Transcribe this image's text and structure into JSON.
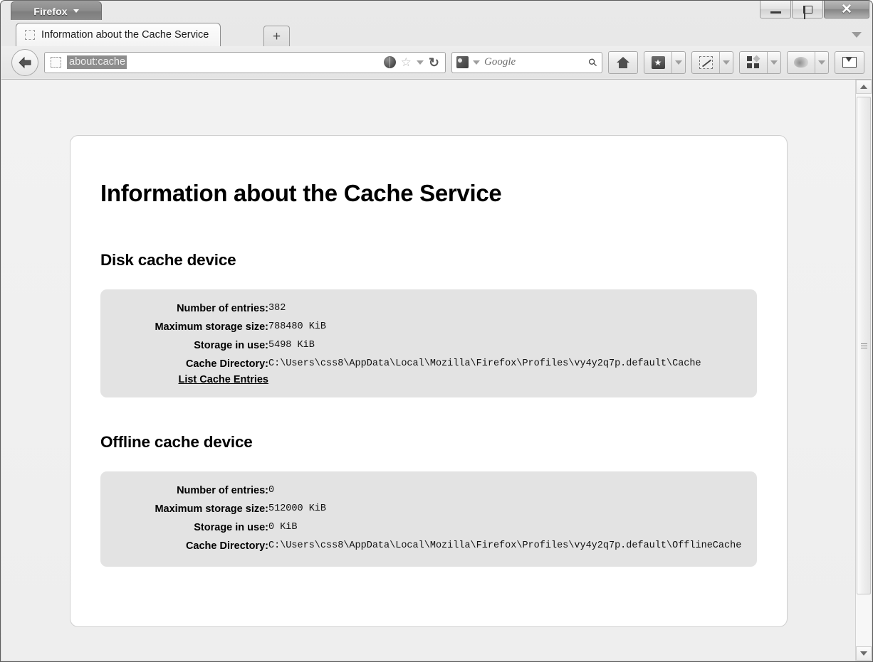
{
  "browser": {
    "app_menu_label": "Firefox",
    "window_controls": {
      "minimize": "minimize-button",
      "maximize": "maximize-button",
      "close": "✕"
    },
    "tab": {
      "title": "Information about the Cache Service",
      "new_tab_label": "+"
    },
    "urlbar": {
      "value": "about:cache"
    },
    "searchbar": {
      "placeholder": "Google",
      "engine": "google-icon",
      "magnifier": "🔍"
    },
    "toolbar_buttons": [
      {
        "name": "home-button",
        "icon": "home-icon"
      },
      {
        "name": "bookmarks-button",
        "icon": "bookmark-star-icon"
      },
      {
        "name": "snip-tool-button",
        "icon": "scissors-select-icon"
      },
      {
        "name": "apps-grid-button",
        "icon": "grid-squares-icon"
      },
      {
        "name": "weather-button",
        "icon": "cloud-icon"
      },
      {
        "name": "mail-button",
        "icon": "envelope-icon"
      }
    ]
  },
  "page": {
    "title": "Information about the Cache Service",
    "sections": [
      {
        "heading": "Disk cache device",
        "rows": [
          {
            "label": "Number of entries:",
            "value": "382"
          },
          {
            "label": "Maximum storage size:",
            "value": "788480 KiB"
          },
          {
            "label": "Storage in use:",
            "value": "5498 KiB"
          },
          {
            "label": "Cache Directory:",
            "value": "C:\\Users\\css8\\AppData\\Local\\Mozilla\\Firefox\\Profiles\\vy4y2q7p.default\\Cache"
          }
        ],
        "link": "List Cache Entries"
      },
      {
        "heading": "Offline cache device",
        "rows": [
          {
            "label": "Number of entries:",
            "value": "0"
          },
          {
            "label": "Maximum storage size:",
            "value": "512000 KiB"
          },
          {
            "label": "Storage in use:",
            "value": "0 KiB"
          },
          {
            "label": "Cache Directory:",
            "value": "C:\\Users\\css8\\AppData\\Local\\Mozilla\\Firefox\\Profiles\\vy4y2q7p.default\\OfflineCache"
          }
        ],
        "link": null
      }
    ]
  }
}
